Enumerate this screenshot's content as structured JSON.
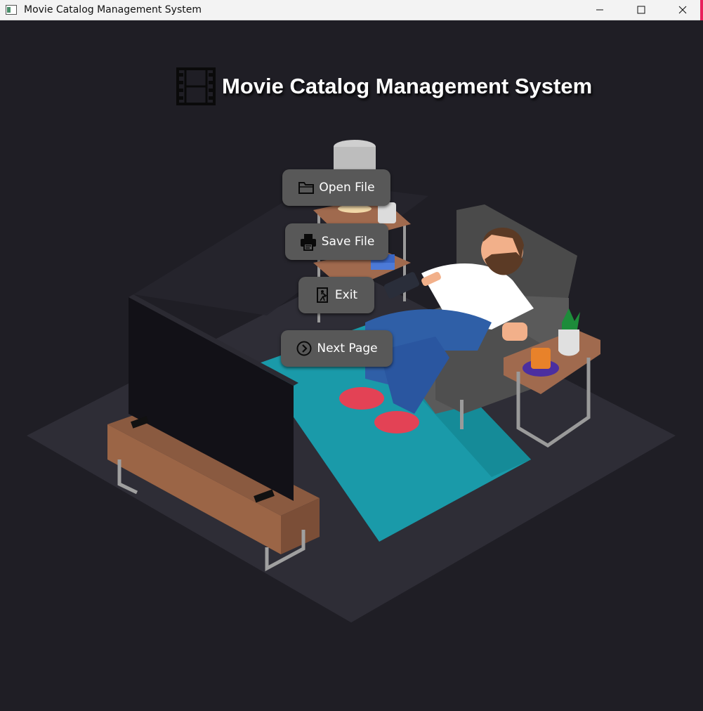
{
  "window": {
    "title": "Movie Catalog Management System",
    "controls": [
      "minimize",
      "maximize",
      "close"
    ]
  },
  "heading": {
    "icon": "film-icon",
    "text": "Movie Catalog Management System"
  },
  "buttons": [
    {
      "label": "Open File",
      "icon": "folder-icon"
    },
    {
      "label": "Save File",
      "icon": "printer-icon"
    },
    {
      "label": "Exit",
      "icon": "exit-door-icon"
    },
    {
      "label": "Next Page",
      "icon": "chevron-right-circle-icon"
    }
  ],
  "colors": {
    "background": "#1f1e25",
    "button": "#585858",
    "button_text": "#ffffff",
    "rug": "#1aa1b0",
    "accent_edge": "#e81f5b"
  }
}
